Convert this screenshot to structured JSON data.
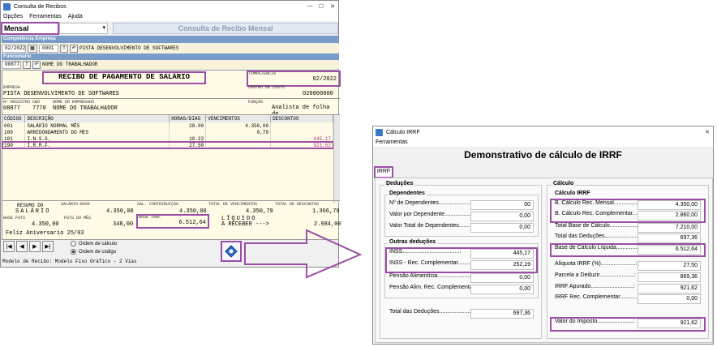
{
  "left": {
    "title": "Consulta de Recibos",
    "menu": [
      "Opções",
      "Ferramentas",
      "Ajuda"
    ],
    "period_select": "Mensal",
    "header_banner": "Consulta de Recibo Mensal",
    "competencia_label": "Competência",
    "empresa_label": "Empresa",
    "competencia_value": "02/2022",
    "empresa_code": "0001",
    "empresa_name": "PISTA DESENVOLVIMENTO DE SOFTWARES",
    "funcionario_label": "Funcionário",
    "funcionario_code": "08877",
    "funcionario_name": "NOME DO TRABALHADOR",
    "receipt": {
      "title": "RECIBO DE PAGAMENTO DE SALÁRIO",
      "competencia_label": "COMPETÊNCIA",
      "competencia": "02/2022",
      "empresa_label": "EMPRESA",
      "empresa": "PISTA DESENVOLVIMENTO DE SOFTWARES",
      "centro_label": "CENTRO DE CUSTO",
      "centro": "020000000",
      "registro_label": "Nº REGISTRO",
      "registro": "08877",
      "cbo_label": "CBO",
      "cbo": "7770",
      "nome_label": "NOME DO EMPREGADO",
      "nome": "NOME DO TRABALHADOR",
      "funcao_label": "FUNÇÃO",
      "funcao": "Analista de folha de"
    },
    "grid_headers": [
      "CÓDIGO",
      "DESCRIÇÃO",
      "HORAS/DIAS",
      "VENCIMENTOS",
      "DESCONTOS"
    ],
    "grid_rows": [
      {
        "cod": "001",
        "desc": "SALÁRIO NORMAL MÊS",
        "horas": "28.00",
        "venc": "4.350,00",
        "desc_val": ""
      },
      {
        "cod": "100",
        "desc": "ARREDONDAMENTO DO MES",
        "horas": "",
        "venc": "0,79",
        "desc_val": ""
      },
      {
        "cod": "101",
        "desc": "I.N.S.S.",
        "horas": "10.23",
        "venc": "",
        "desc_val": "445,17"
      },
      {
        "cod": "190",
        "desc": "I.R.R.F.",
        "horas": "27.50",
        "venc": "",
        "desc_val": "921,62"
      }
    ],
    "summary": {
      "resumo_label": "RESUMO DO",
      "resumo_sub": "SALÁRIO",
      "salario_base_label": "SALÁRIO-BASE",
      "salario_base": "4.350,00",
      "sal_contrib_label": "SAL. CONTRIBUIÇÃO",
      "sal_contrib": "4.350,00",
      "total_venc_label": "TOTAL DE VENCIMENTOS",
      "total_venc": "4.350,79",
      "total_desc_label": "TOTAL DE DESCONTOS",
      "total_desc": "1.366,79",
      "base_fgts_label": "BASE FGTS",
      "base_fgts": "4.350,00",
      "fgts_mes_label": "FGTS DO MÊS",
      "fgts_mes": "348,00",
      "base_irrf_label": "BASE IRRF",
      "base_irrf": "6.512,64",
      "liquido_label": "LÍQUIDO",
      "a_receber": "A RECEBER --->",
      "liquido": "2.984,00"
    },
    "footer_msg": "Feliz Aniversario 25/03",
    "radio_calc": "Ordem de cálculo",
    "radio_code": "Ordem de código",
    "modelo": "Modelo de Recibo: Modelo Fixo Gráfico - 2 Vias",
    "nav": [
      "|◀",
      "◀",
      "▶",
      "▶|"
    ]
  },
  "right": {
    "title": "Cálculo IRRF",
    "menu": "Ferramentas",
    "heading": "Demonstrativo de cálculo de IRRF",
    "tab": "IRRF",
    "deducoes_title": "Deduções",
    "dependentes_title": "Dependentes",
    "dependentes": [
      {
        "label": "Nº de Dependentes......................:",
        "value": "00"
      },
      {
        "label": "Valor por Dependente...................:",
        "value": "0,00"
      },
      {
        "label": "Valor Total de Dependentes.............:",
        "value": "0,00"
      }
    ],
    "outras_title": "Outras deduções",
    "outras": [
      {
        "label": "INSS....................................:",
        "value": "445,17"
      },
      {
        "label": "INSS - Rec. Complementar................:",
        "value": "252,19"
      },
      {
        "label": "Pensão Alimentícia......................:",
        "value": "0,00"
      },
      {
        "label": "Pensão Alim. Rec. Complementar..........:",
        "value": "0,00"
      }
    ],
    "total_deducoes": {
      "label": "Total das Deduções......................:",
      "value": "697,36"
    },
    "calculo_title": "Cálculo",
    "calculo_irrf_title": "Cálculo IRRF",
    "calc_rows": [
      {
        "label": "B. Cálculo Rec. Mensal.................:",
        "value": "4.350,00"
      },
      {
        "label": "B. Cálculo Rec. Complementar.........:",
        "value": "2.860,00"
      },
      {
        "label": "Total Base de Cálculo..................:",
        "value": "7.210,00"
      },
      {
        "label": "Total das Deduções.....................:",
        "value": "697,36"
      },
      {
        "label": "Base de Cálculo Líquida...............:",
        "value": "6.512,64"
      }
    ],
    "calc_rows2": [
      {
        "label": "Alíquota IRRF (%)......................:",
        "value": "27,50"
      },
      {
        "label": "Parcela a Deduzir......................:",
        "value": "869,36"
      },
      {
        "label": "IRRF Apurado...........................:",
        "value": "921,62"
      },
      {
        "label": "IRRF Rec. Complementar.................:",
        "value": "0,00"
      }
    ],
    "valor_imposto": {
      "label": "Valor do Imposto.......................:",
      "value": "921,62"
    }
  },
  "colors": {
    "highlight": "#9b4ea6",
    "accent": "#3a78c9",
    "receipt_bg": "#fffbe6"
  }
}
